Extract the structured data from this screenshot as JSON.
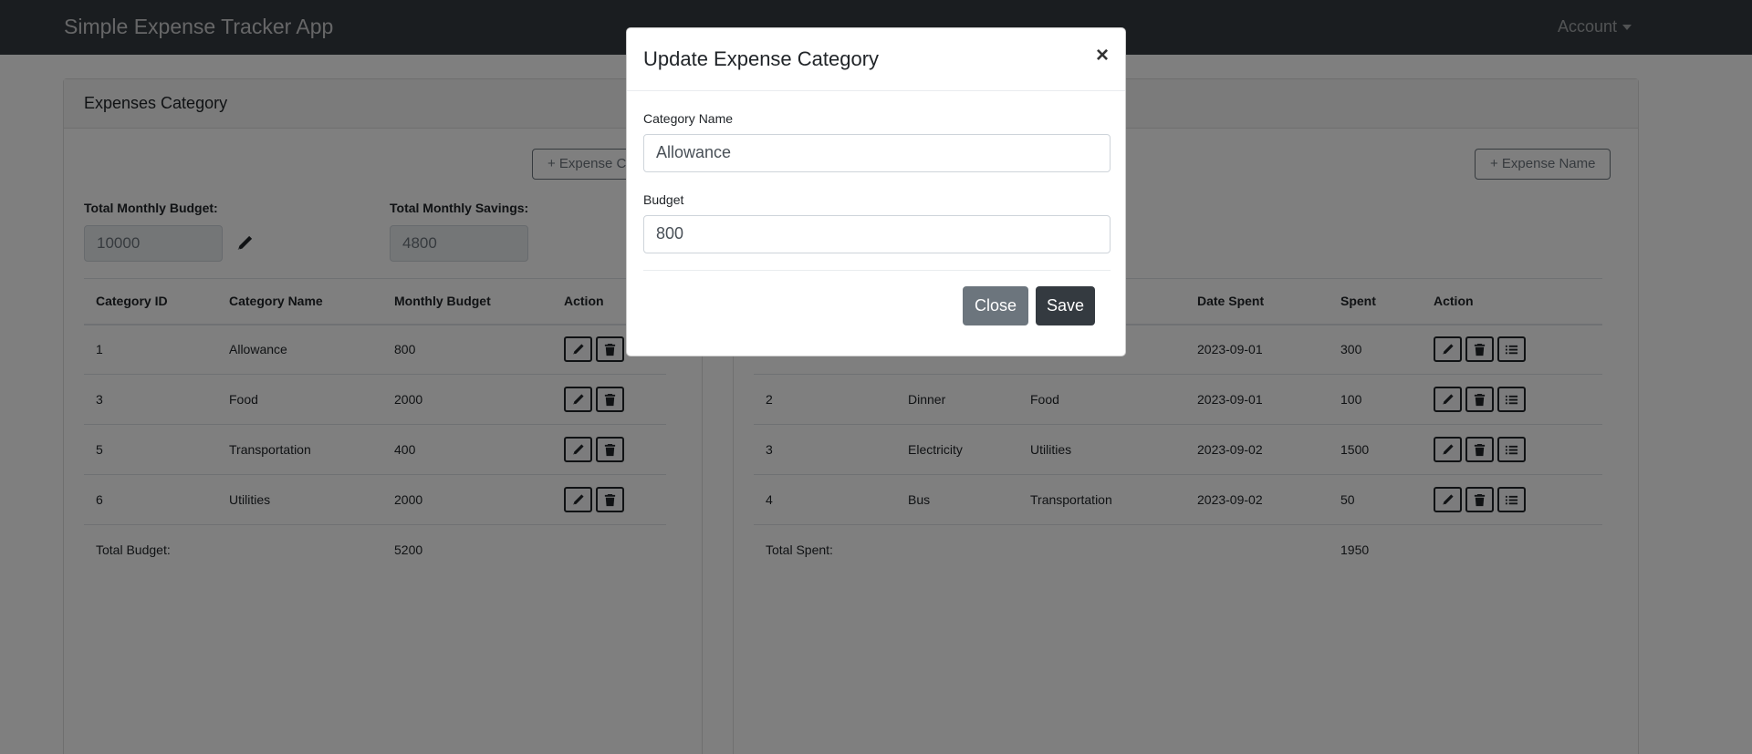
{
  "navbar": {
    "brand": "Simple Expense Tracker App",
    "account": "Account"
  },
  "left_card": {
    "header": "Expenses Category",
    "add_button": "+ Expense Category",
    "budget_label": "Total Monthly Budget:",
    "budget_value": "10000",
    "savings_label": "Total Monthly Savings:",
    "savings_value": "4800",
    "columns": [
      "Category ID",
      "Category Name",
      "Monthly Budget",
      "Action"
    ],
    "rows": [
      {
        "id": "1",
        "name": "Allowance",
        "budget": "800"
      },
      {
        "id": "3",
        "name": "Food",
        "budget": "2000"
      },
      {
        "id": "5",
        "name": "Transportation",
        "budget": "400"
      },
      {
        "id": "6",
        "name": "Utilities",
        "budget": "2000"
      }
    ],
    "total_label": "Total Budget:",
    "total_value": "5200"
  },
  "right_card": {
    "add_button": "+ Expense Name",
    "columns": [
      "",
      "",
      "",
      "Date Spent",
      "Spent",
      "Action"
    ],
    "rows": [
      {
        "id": "",
        "name": "",
        "category": "",
        "date": "2023-09-01",
        "spent": "300"
      },
      {
        "id": "2",
        "name": "Dinner",
        "category": "Food",
        "date": "2023-09-01",
        "spent": "100"
      },
      {
        "id": "3",
        "name": "Electricity",
        "category": "Utilities",
        "date": "2023-09-02",
        "spent": "1500"
      },
      {
        "id": "4",
        "name": "Bus",
        "category": "Transportation",
        "date": "2023-09-02",
        "spent": "50"
      }
    ],
    "total_label": "Total Spent:",
    "total_value": "1950"
  },
  "modal": {
    "title": "Update Expense Category",
    "close_symbol": "×",
    "category_label": "Category Name",
    "category_value": "Allowance",
    "budget_label": "Budget",
    "budget_value": "800",
    "close_button": "Close",
    "save_button": "Save"
  },
  "colors": {
    "navbar": "#343a40",
    "backdrop": "rgba(0,0,0,0.5)",
    "secondary": "#6c757d",
    "dark": "#343a40"
  },
  "icons": {
    "edit": "pencil-icon",
    "delete": "trash-icon",
    "details": "list-icon"
  }
}
